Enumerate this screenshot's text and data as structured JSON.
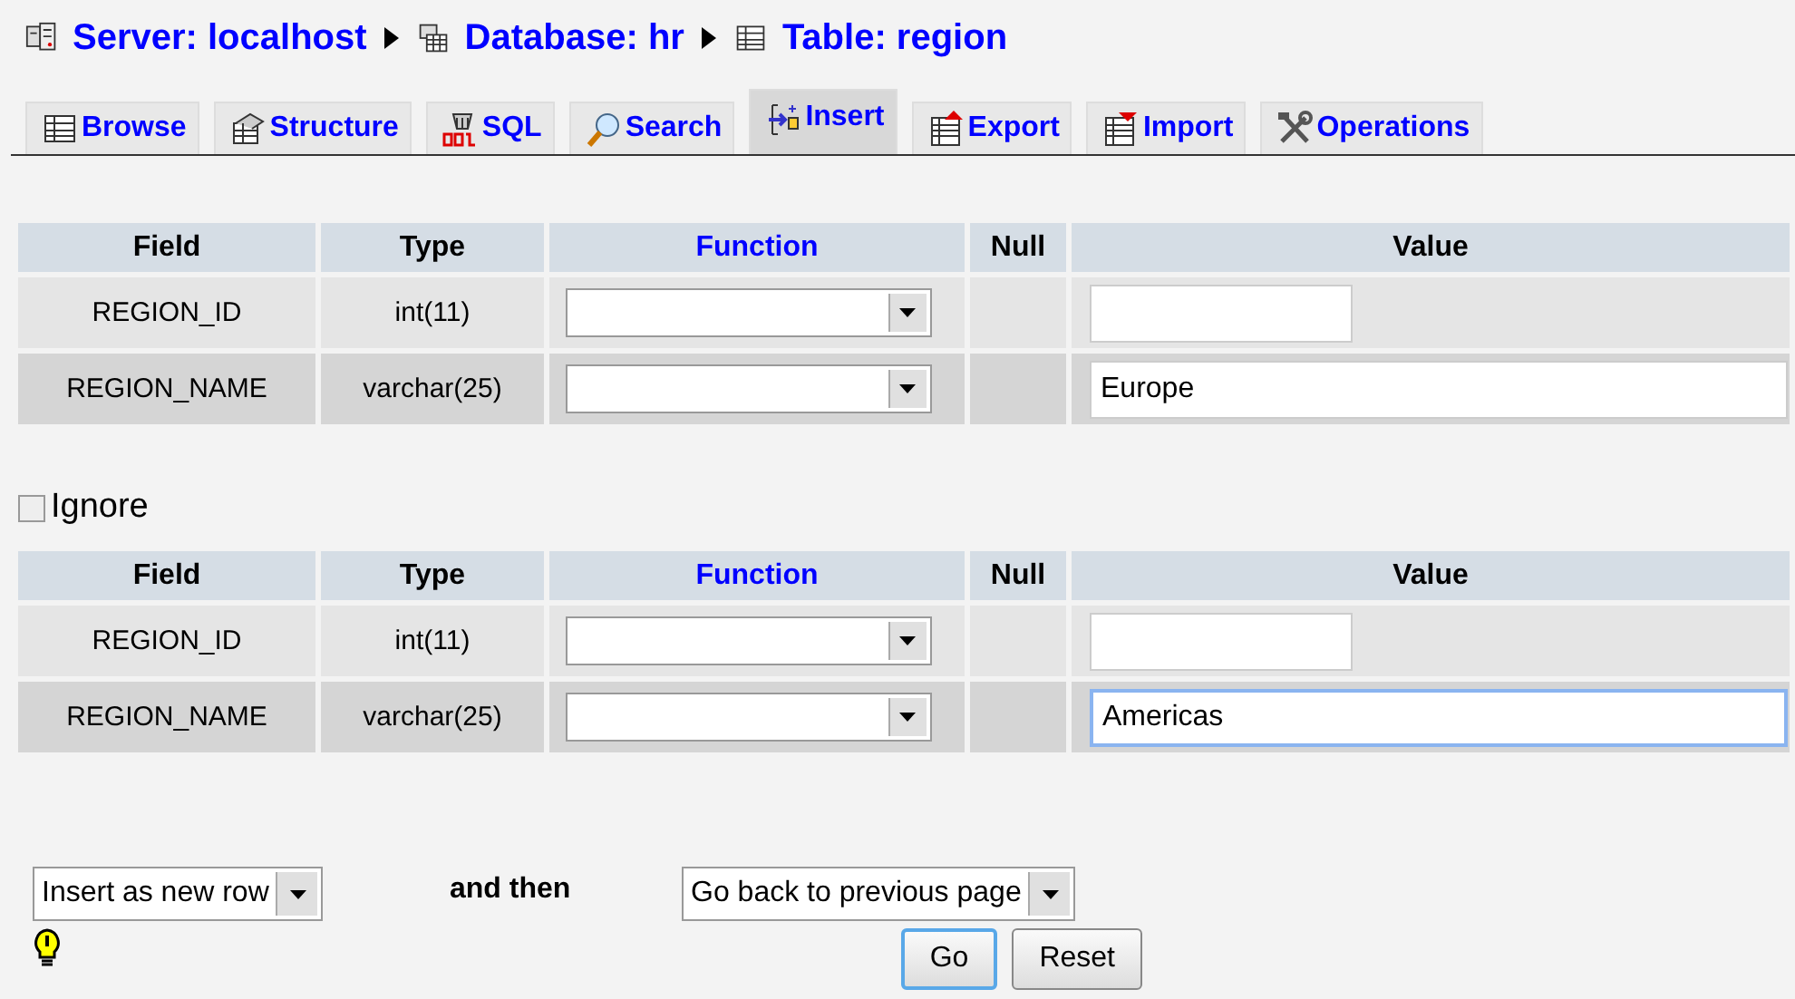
{
  "breadcrumb": [
    {
      "kind": "server",
      "label": "Server: localhost"
    },
    {
      "kind": "database",
      "label": "Database: hr"
    },
    {
      "kind": "table",
      "label": "Table: region"
    }
  ],
  "tabs": [
    {
      "label": "Browse",
      "selected": false
    },
    {
      "label": "Structure",
      "selected": false
    },
    {
      "label": "SQL",
      "selected": false
    },
    {
      "label": "Search",
      "selected": false
    },
    {
      "label": "Insert",
      "selected": true
    },
    {
      "label": "Export",
      "selected": false
    },
    {
      "label": "Import",
      "selected": false
    },
    {
      "label": "Operations",
      "selected": false
    }
  ],
  "forms": [
    {
      "columns": [
        {
          "label": "Field",
          "link": false
        },
        {
          "label": "Type",
          "link": false
        },
        {
          "label": "Function",
          "link": true
        },
        {
          "label": "Null",
          "link": false
        },
        {
          "label": "Value",
          "link": false
        }
      ],
      "rows": [
        {
          "field": "REGION_ID",
          "type": "int(11)",
          "kind": "short",
          "focused": false
        },
        {
          "field": "REGION_NAME",
          "type": "varchar(25)",
          "kind": "long",
          "value": "Europe",
          "focused": false
        }
      ]
    },
    {
      "ignore": {
        "label": "Ignore",
        "checked": false
      },
      "columns": [
        {
          "label": "Field",
          "link": false
        },
        {
          "label": "Type",
          "link": false
        },
        {
          "label": "Function",
          "link": true
        },
        {
          "label": "Null",
          "link": false
        },
        {
          "label": "Value",
          "link": false
        }
      ],
      "rows": [
        {
          "field": "REGION_ID",
          "type": "int(11)",
          "kind": "short",
          "focused": false
        },
        {
          "field": "REGION_NAME",
          "type": "varchar(25)",
          "kind": "long",
          "value": "Americas",
          "focused": true
        }
      ]
    }
  ],
  "footer": {
    "insert_mode": "Insert as new row",
    "and_then": "and then",
    "after_insert": "Go back to previous page",
    "buttons": [
      {
        "label": "Go",
        "focused": true
      },
      {
        "label": "Reset",
        "focused": false
      }
    ]
  }
}
